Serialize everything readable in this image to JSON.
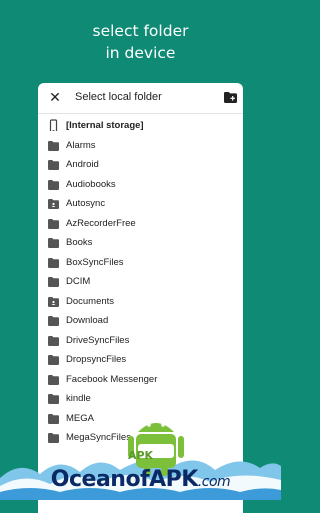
{
  "headline": {
    "line1": "select folder",
    "line2": "in device"
  },
  "dialog": {
    "title": "Select local folder",
    "close_icon": "close-icon",
    "new_folder_icon": "create-new-folder-icon"
  },
  "storage": {
    "label": "[Internal storage]",
    "icon": "phone-icon"
  },
  "folders": [
    {
      "label": "Alarms",
      "icon": "folder-icon"
    },
    {
      "label": "Android",
      "icon": "folder-icon"
    },
    {
      "label": "Audiobooks",
      "icon": "folder-icon"
    },
    {
      "label": "Autosync",
      "icon": "shared-folder-icon"
    },
    {
      "label": "AzRecorderFree",
      "icon": "folder-icon"
    },
    {
      "label": "Books",
      "icon": "folder-icon"
    },
    {
      "label": "BoxSyncFiles",
      "icon": "folder-icon"
    },
    {
      "label": "DCIM",
      "icon": "folder-icon"
    },
    {
      "label": "Documents",
      "icon": "shared-folder-icon"
    },
    {
      "label": "Download",
      "icon": "folder-icon"
    },
    {
      "label": "DriveSyncFiles",
      "icon": "folder-icon"
    },
    {
      "label": "DropsyncFiles",
      "icon": "folder-icon"
    },
    {
      "label": "Facebook Messenger",
      "icon": "folder-icon"
    },
    {
      "label": "kindle",
      "icon": "folder-icon"
    },
    {
      "label": "MEGA",
      "icon": "folder-icon"
    },
    {
      "label": "MegaSyncFiles",
      "icon": "folder-icon"
    }
  ],
  "watermark": {
    "text_main": "OceanofAPK",
    "text_suffix": ".com",
    "badge": "APK"
  },
  "colors": {
    "background": "#0f8a74",
    "folder": "#555555",
    "android_green": "#7cbf3a",
    "watermark_blue": "#0a2a66"
  }
}
